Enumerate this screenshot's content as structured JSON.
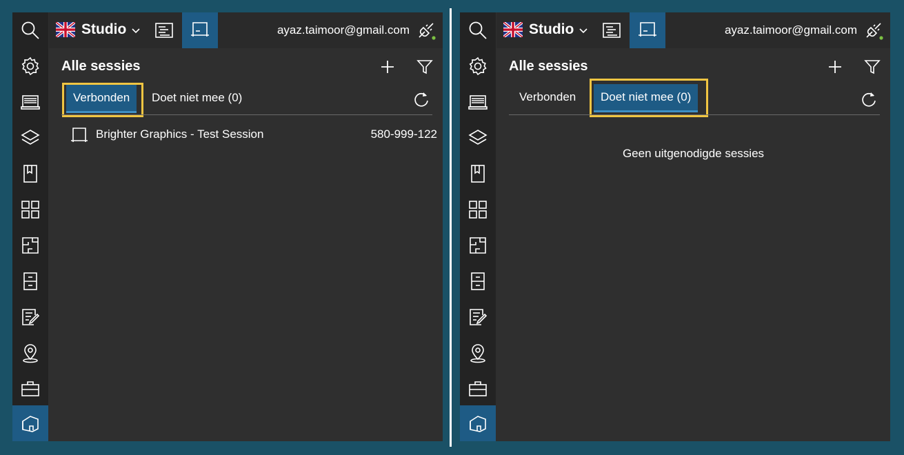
{
  "left": {
    "header": {
      "app": "Studio",
      "email": "ayaz.taimoor@gmail.com"
    },
    "title": "Alle sessies",
    "tabs": [
      "Verbonden",
      "Doet niet mee (0)"
    ],
    "sessions": [
      {
        "name": "Brighter Graphics - Test Session",
        "number": "580-999-122"
      }
    ]
  },
  "right": {
    "header": {
      "app": "Studio",
      "email": "ayaz.taimoor@gmail.com"
    },
    "title": "Alle sessies",
    "tabs": [
      "Verbonden",
      "Doet niet mee (0)"
    ],
    "empty_message": "Geen uitgenodigde sessies"
  },
  "colors": {
    "accent": "#1e5b85",
    "highlight": "#f0c542",
    "background": "#1a5166",
    "panel": "#2f2f2f",
    "status_dot": "#7cc142"
  },
  "icons": {
    "rail": [
      "search-icon",
      "gear-icon",
      "library-icon",
      "layers-icon",
      "book-icon",
      "grid-icon",
      "floorplan-icon",
      "cabinet-icon",
      "edit-form-icon",
      "location-pin-icon",
      "briefcase-icon",
      "home-3d-icon"
    ],
    "toolbar": [
      "flag-uk-icon",
      "chevron-down-icon",
      "document-icon",
      "session-icon",
      "plug-icon",
      "plus-icon",
      "filter-icon",
      "refresh-icon"
    ]
  }
}
